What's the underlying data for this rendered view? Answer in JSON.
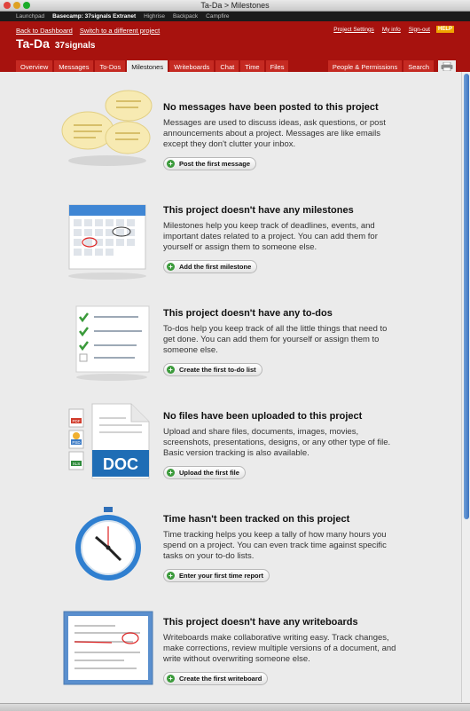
{
  "window": {
    "title": "Ta-Da > Milestones"
  },
  "global_nav": {
    "items": [
      "Launchpad",
      "Basecamp: 37signals Extranet",
      "Highrise",
      "Backpack",
      "Campfire"
    ]
  },
  "header": {
    "back_to_dashboard": "Back to Dashboard",
    "switch_project": "Switch to a different project",
    "project_settings": "Project Settings",
    "my_info": "My info",
    "sign_out": "Sign-out",
    "help": "HELP",
    "project_name": "Ta-Da",
    "company_name": "37signals"
  },
  "tabs": [
    "Overview",
    "Messages",
    "To-Dos",
    "Milestones",
    "Writeboards",
    "Chat",
    "Time",
    "Files"
  ],
  "active_tab": "Milestones",
  "right_tabs": [
    "People & Permissions",
    "Search"
  ],
  "sections": [
    {
      "title": "No messages have been posted to this project",
      "body": "Messages are used to discuss ideas, ask questions, or post announcements about a project. Messages are like emails except they don't clutter your inbox.",
      "button": "Post the first message",
      "icon": "speech-bubbles-icon"
    },
    {
      "title": "This project doesn't have any milestones",
      "body": "Milestones help you keep track of deadlines, events, and important dates related to a project. You can add them for yourself or assign them to someone else.",
      "button": "Add the first milestone",
      "icon": "calendar-icon"
    },
    {
      "title": "This project doesn't have any to-dos",
      "body": "To-dos help you keep track of all the little things that need to get done. You can add them for yourself or assign them to someone else.",
      "button": "Create the first to-do list",
      "icon": "checklist-icon"
    },
    {
      "title": "No files have been uploaded to this project",
      "body": "Upload and share files, documents, images, movies, screenshots, presentations, designs, or any other type of file. Basic version tracking is also available.",
      "button": "Upload the first file",
      "icon": "document-icon"
    },
    {
      "title": "Time hasn't been tracked on this project",
      "body": "Time tracking helps you keep a tally of how many hours you spend on a project. You can even track time against specific tasks on your to-do lists.",
      "button": "Enter your first time report",
      "icon": "stopwatch-icon"
    },
    {
      "title": "This project doesn't have any writeboards",
      "body": "Writeboards make collaborative writing easy. Track changes, make corrections, review multiple versions of a document, and write without overwriting someone else.",
      "button": "Create the first writeboard",
      "icon": "writeboard-icon"
    }
  ],
  "file_badges": [
    "PDF",
    "PSD",
    "XLS"
  ],
  "doc_label": "DOC",
  "colors": {
    "header": "#a7120e",
    "tab": "#c52a22",
    "plus": "#3a9a3a",
    "doc": "#1f6db5"
  }
}
